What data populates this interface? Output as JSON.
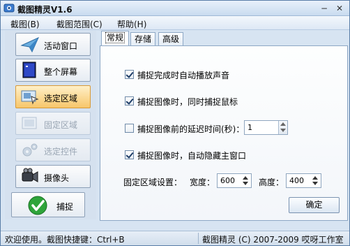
{
  "window": {
    "title": "截图精灵V1.6",
    "minimize_glyph": "−",
    "close_glyph": "✕"
  },
  "menu": [
    "截图(B)",
    "截图范围(C)",
    "帮助(H)"
  ],
  "sidebar": {
    "items": [
      {
        "label": "活动窗口",
        "icon": "paper-plane-icon",
        "state": "normal"
      },
      {
        "label": "整个屏幕",
        "icon": "monitor-icon",
        "state": "normal"
      },
      {
        "label": "选定区域",
        "icon": "region-select-icon",
        "state": "active"
      },
      {
        "label": "固定区域",
        "icon": "fixed-region-icon",
        "state": "disabled"
      },
      {
        "label": "选定控件",
        "icon": "gears-icon",
        "state": "disabled"
      },
      {
        "label": "摄像头",
        "icon": "camera-icon",
        "state": "normal"
      }
    ],
    "capture_label": "捕捉",
    "capture_icon": "checkmark-icon"
  },
  "tabs": [
    "常规",
    "存储",
    "高级"
  ],
  "settings": {
    "play_sound": {
      "label": "捕捉完成时自动播放声音",
      "checked": true
    },
    "capture_cursor": {
      "label": "捕捉图像时，同时捕捉鼠标",
      "checked": true
    },
    "delay": {
      "label": "捕捉图像前的延迟时间(秒)：",
      "checked": false,
      "value": "1"
    },
    "hide_window": {
      "label": "捕捉图像时，自动隐藏主窗口",
      "checked": true
    },
    "fixed_region": {
      "label": "固定区域设置：",
      "width_label": "宽度：",
      "width_value": "600",
      "height_label": "高度：",
      "height_value": "400"
    },
    "ok_label": "确定"
  },
  "status": {
    "left": "欢迎使用。截图快捷键：Ctrl+B",
    "right": "截图精灵 (C) 2007-2009 哎呀工作室"
  },
  "colors": {
    "active_button": "#f7c66a",
    "accent": "#5a7ea8",
    "check": "#1f3e68"
  }
}
